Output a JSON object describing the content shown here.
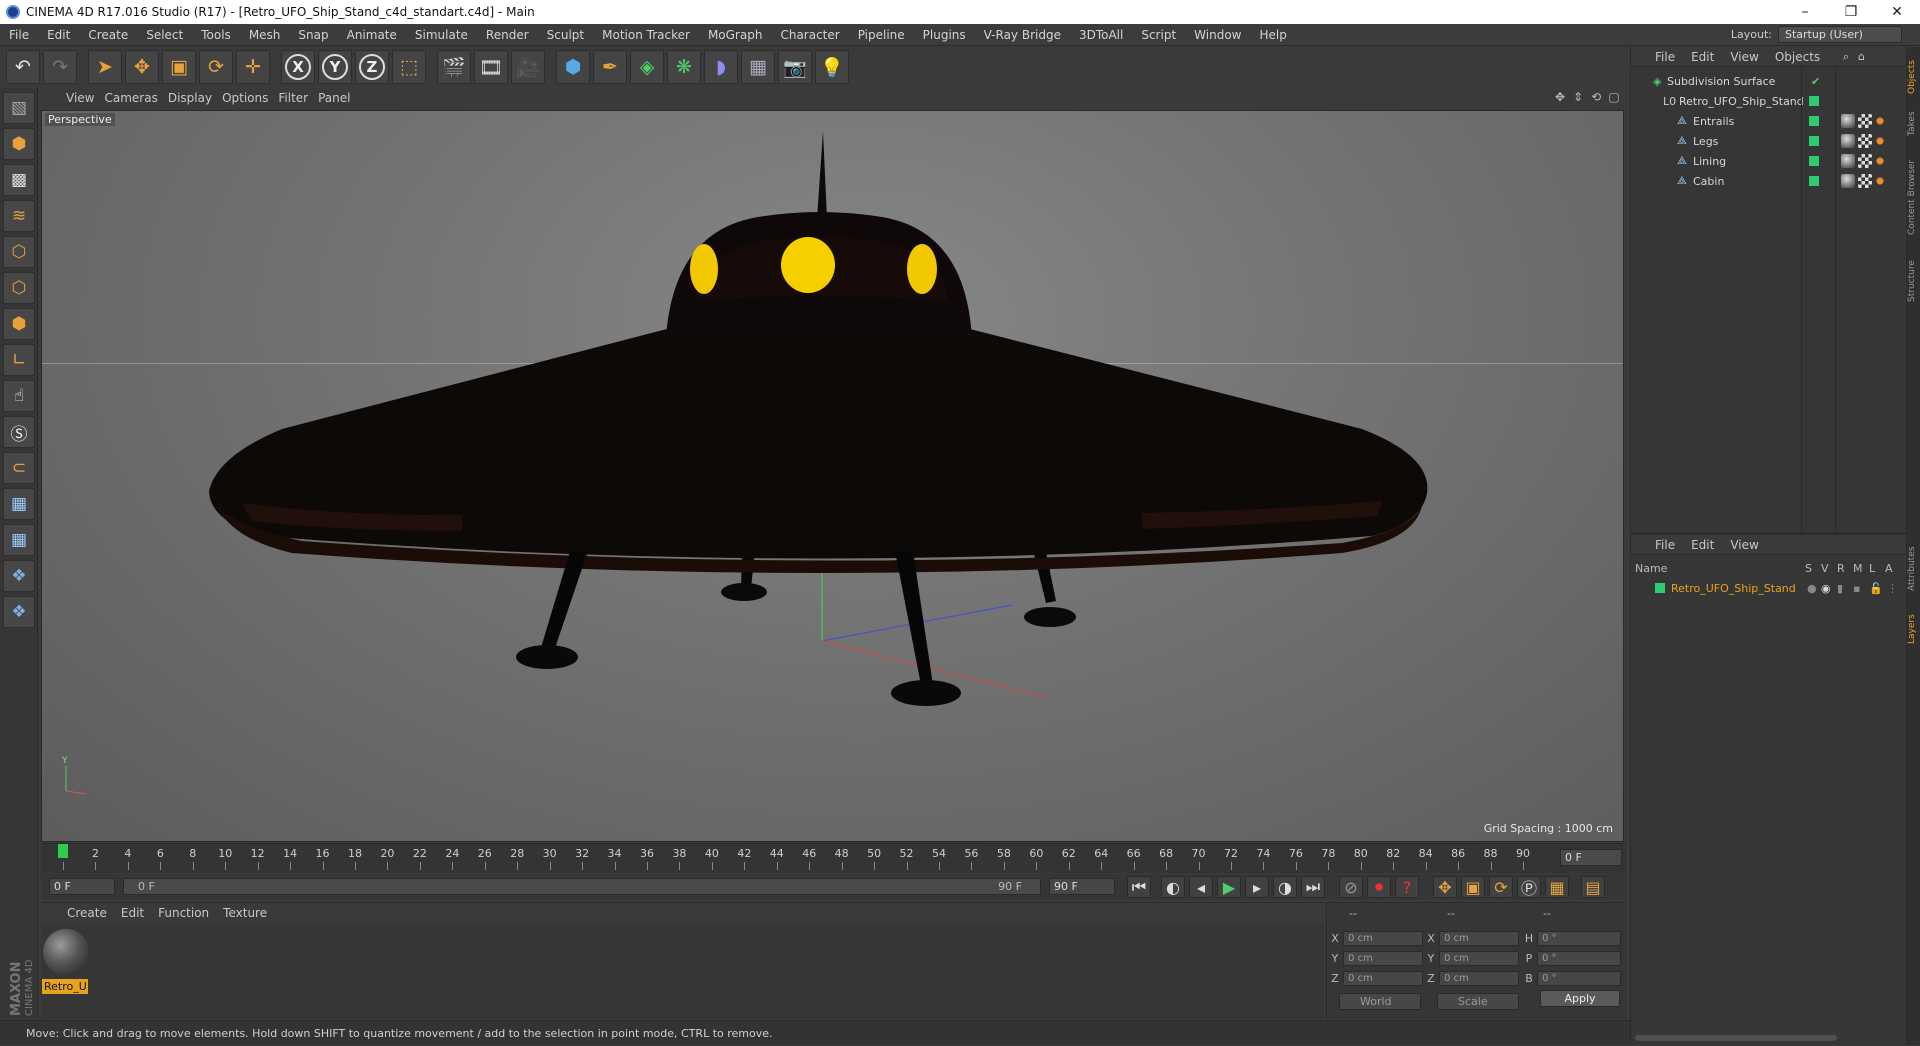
{
  "window": {
    "title": "CINEMA 4D R17.016 Studio (R17) - [Retro_UFO_Ship_Stand_c4d_standart.c4d] - Main",
    "minimize": "–",
    "maximize": "❐",
    "close": "✕"
  },
  "menu": [
    "File",
    "Edit",
    "Create",
    "Select",
    "Tools",
    "Mesh",
    "Snap",
    "Animate",
    "Simulate",
    "Render",
    "Sculpt",
    "Motion Tracker",
    "MoGraph",
    "Character",
    "Pipeline",
    "Plugins",
    "V-Ray Bridge",
    "3DToAll",
    "Script",
    "Window",
    "Help"
  ],
  "layout": {
    "label": "Layout:",
    "value": "Startup (User)"
  },
  "viewport": {
    "menu": [
      "View",
      "Cameras",
      "Display",
      "Options",
      "Filter",
      "Panel"
    ],
    "camera": "Perspective",
    "grid_spacing": "Grid Spacing : 1000 cm"
  },
  "timeline": {
    "ticks": [
      0,
      2,
      4,
      6,
      8,
      10,
      12,
      14,
      16,
      18,
      20,
      22,
      24,
      26,
      28,
      30,
      32,
      34,
      36,
      38,
      40,
      42,
      44,
      46,
      48,
      50,
      52,
      54,
      56,
      58,
      60,
      62,
      64,
      66,
      68,
      70,
      72,
      74,
      76,
      78,
      80,
      82,
      84,
      86,
      88,
      90
    ],
    "end_frame_field": "0 F",
    "current_frame": 0
  },
  "transport": {
    "start_field": "0 F",
    "range_start": "0 F",
    "range_end": "90 F",
    "end_field": "90 F"
  },
  "material_manager": {
    "menu": [
      "Create",
      "Edit",
      "Function",
      "Texture"
    ],
    "material_name": "Retro_U"
  },
  "coordinates": {
    "headers": [
      "--",
      "--",
      "--"
    ],
    "rows": [
      {
        "a": "X",
        "av": "0 cm",
        "b": "X",
        "bv": "0 cm",
        "c": "H",
        "cv": "0 °"
      },
      {
        "a": "Y",
        "av": "0 cm",
        "b": "Y",
        "bv": "0 cm",
        "c": "P",
        "cv": "0 °"
      },
      {
        "a": "Z",
        "av": "0 cm",
        "b": "Z",
        "bv": "0 cm",
        "c": "B",
        "cv": "0 °"
      }
    ],
    "space": "World",
    "mode": "Scale",
    "apply": "Apply"
  },
  "status": "Move: Click and drag to move elements. Hold down SHIFT to quantize movement / add to the selection in point mode, CTRL to remove.",
  "object_manager": {
    "menu": [
      "File",
      "Edit",
      "View",
      "Objects"
    ],
    "objects": [
      {
        "name": "Subdivision Surface",
        "level": 0,
        "color": "#2ecc71"
      },
      {
        "name": "Retro_UFO_Ship_Stand",
        "level": 1,
        "color": "#2ecc71"
      },
      {
        "name": "Entrails",
        "level": 2,
        "color": "#2ecc71"
      },
      {
        "name": "Legs",
        "level": 2,
        "color": "#2ecc71"
      },
      {
        "name": "Lining",
        "level": 2,
        "color": "#2ecc71"
      },
      {
        "name": "Cabin",
        "level": 2,
        "color": "#2ecc71"
      }
    ]
  },
  "layer_manager": {
    "menu": [
      "File",
      "Edit",
      "View"
    ],
    "columns": [
      "Name",
      "S",
      "V",
      "R",
      "M",
      "L",
      "A"
    ],
    "layers": [
      {
        "name": "Retro_UFO_Ship_Stand",
        "color": "#2ecc71"
      }
    ]
  },
  "side_tabs": [
    "Objects",
    "Takes",
    "Content Browser",
    "Structure",
    "Attributes",
    "Layers"
  ],
  "maxon": "MAXON\nCINEMA 4D"
}
